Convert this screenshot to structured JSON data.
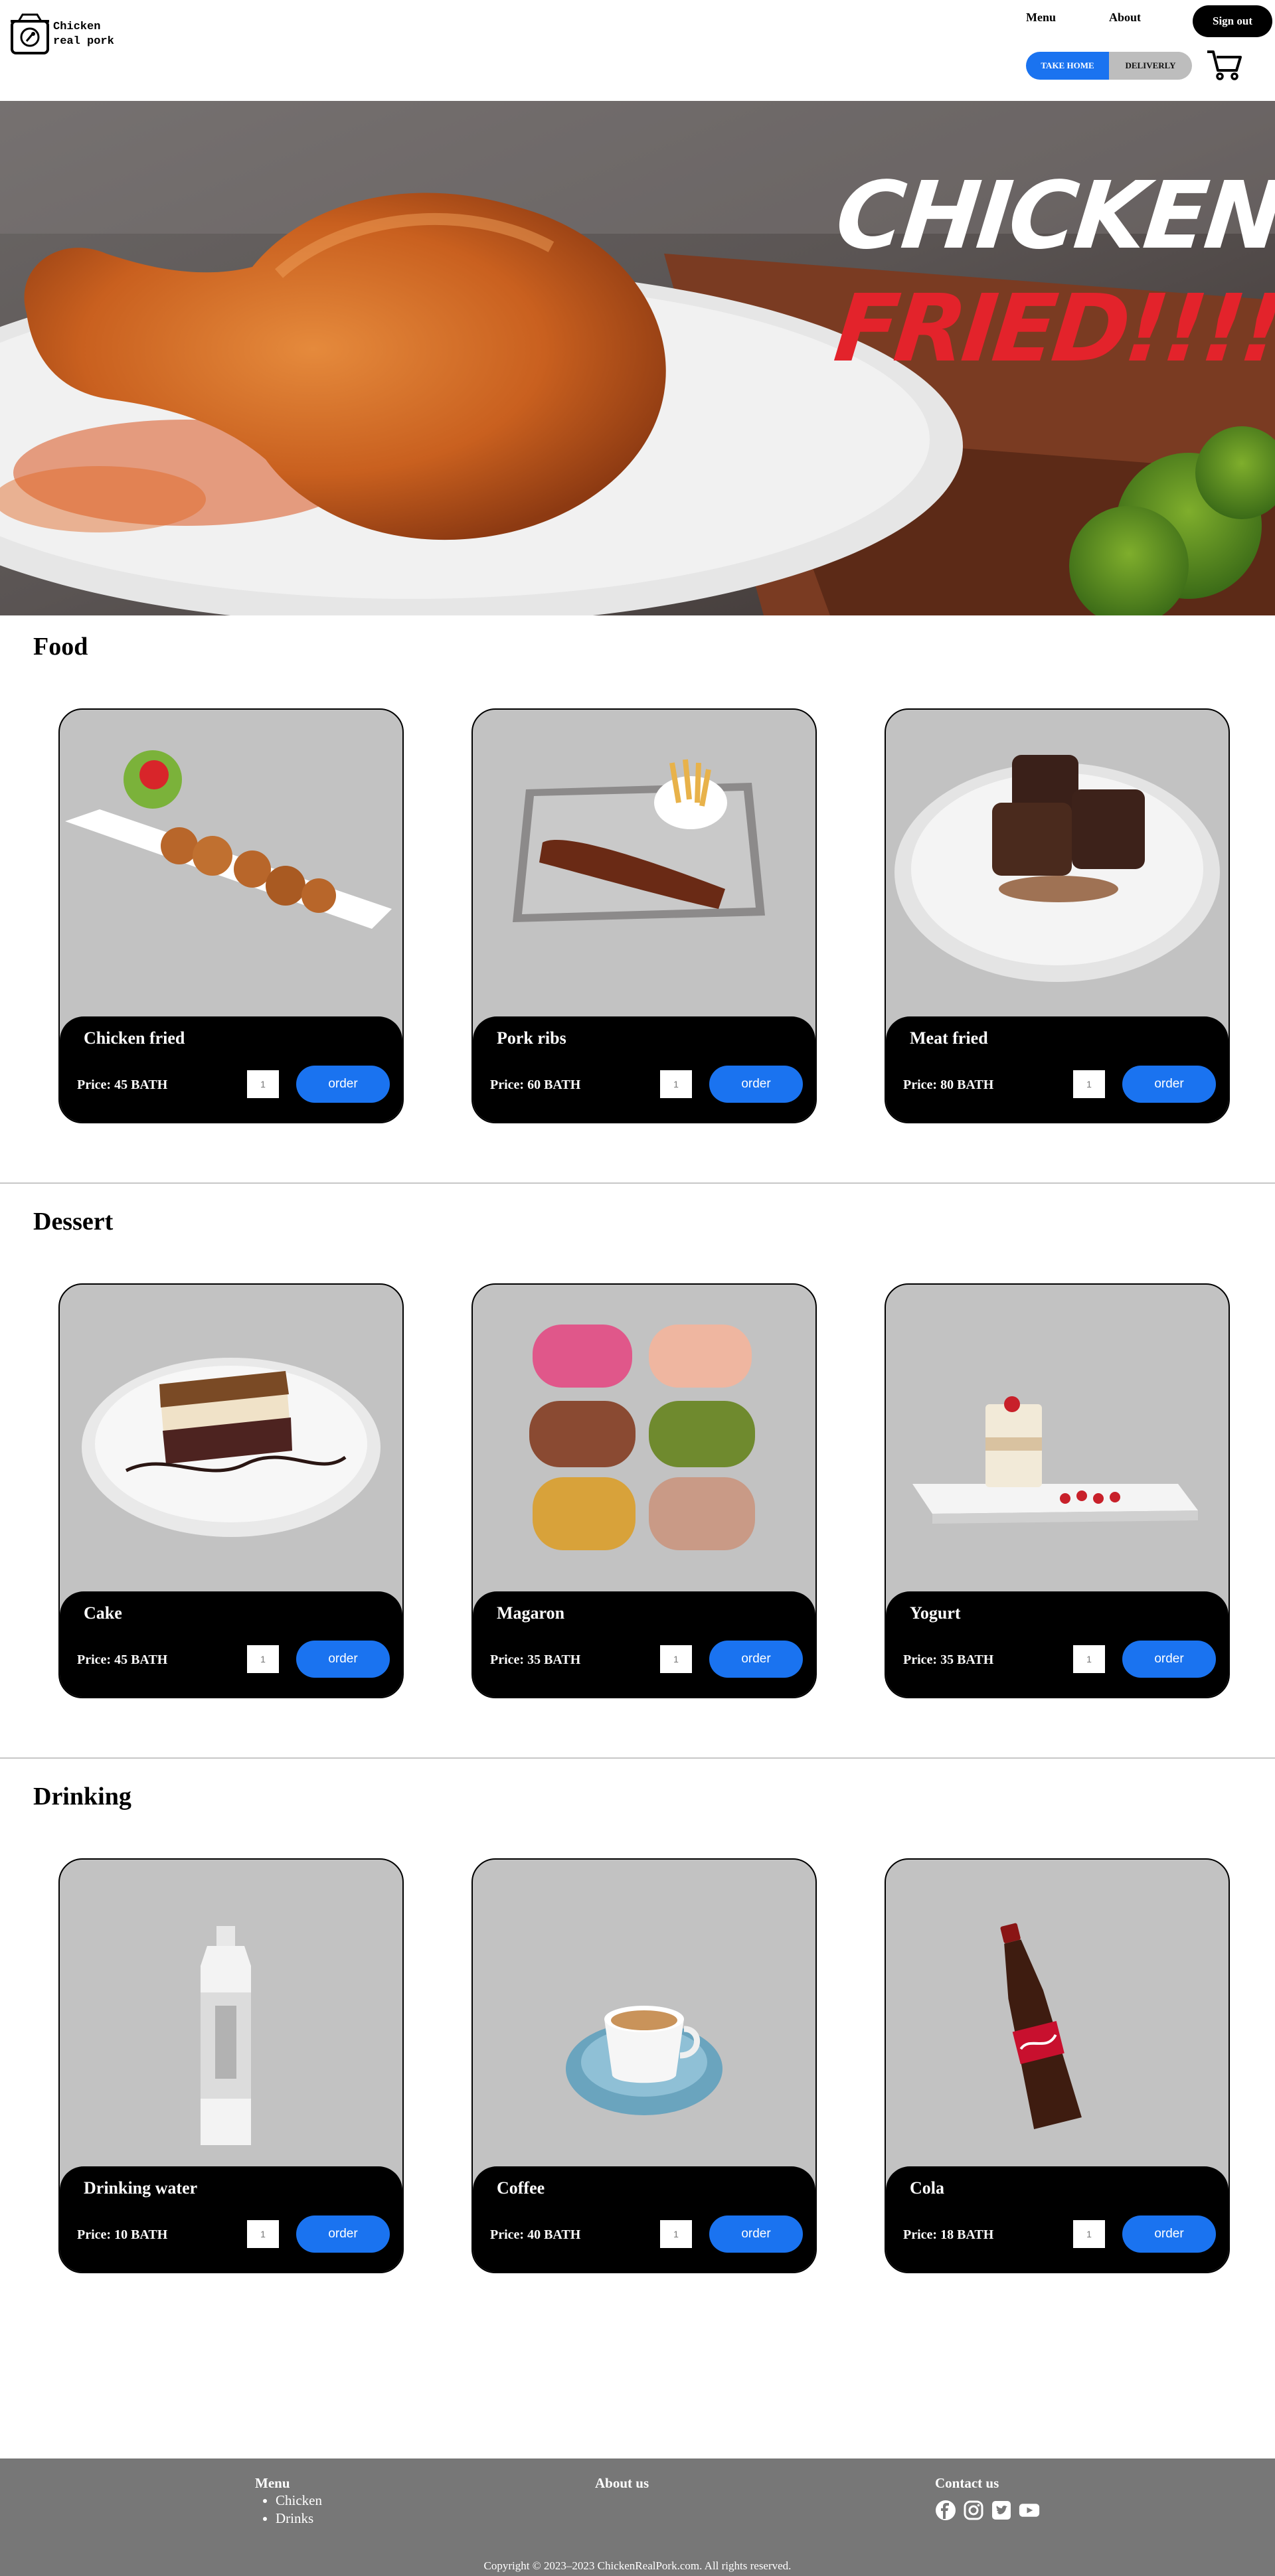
{
  "header": {
    "logo_text": "Chicken\nreal pork",
    "nav": {
      "menu": "Menu",
      "about": "About"
    },
    "sign_out": "Sign out",
    "mode_toggle": {
      "take_home": "TAKE HOME",
      "delivery": "DELIVERLY",
      "selected": "TAKE HOME"
    },
    "icons": {
      "logo": "pot-icon",
      "cart": "cart-icon"
    }
  },
  "hero": {
    "line1": "CHICKEN",
    "line2": "FRIED!!!!!!!!"
  },
  "sections": [
    {
      "title": "Food",
      "items": [
        {
          "name": "Chicken fried",
          "price": "Price: 45 BATH",
          "qty_placeholder": "1",
          "order": "order"
        },
        {
          "name": "Pork ribs",
          "price": "Price: 60 BATH",
          "qty_placeholder": "1",
          "order": "order"
        },
        {
          "name": "Meat fried",
          "price": "Price: 80 BATH",
          "qty_placeholder": "1",
          "order": "order"
        }
      ]
    },
    {
      "title": "Dessert",
      "items": [
        {
          "name": "Cake",
          "price": "Price: 45 BATH",
          "qty_placeholder": "1",
          "order": "order"
        },
        {
          "name": "Magaron",
          "price": "Price: 35 BATH",
          "qty_placeholder": "1",
          "order": "order"
        },
        {
          "name": "Yogurt",
          "price": "Price: 35 BATH",
          "qty_placeholder": "1",
          "order": "order"
        }
      ]
    },
    {
      "title": "Drinking",
      "items": [
        {
          "name": "Drinking water",
          "price": "Price: 10 BATH",
          "qty_placeholder": "1",
          "order": "order"
        },
        {
          "name": "Coffee",
          "price": "Price: 40 BATH",
          "qty_placeholder": "1",
          "order": "order"
        },
        {
          "name": "Cola",
          "price": "Price: 18 BATH",
          "qty_placeholder": "1",
          "order": "order"
        }
      ]
    }
  ],
  "footer": {
    "menu_title": "Menu",
    "menu_items": [
      "Chicken",
      "Drinks"
    ],
    "about_title": "About us",
    "contact_title": "Contact us",
    "social_icons": [
      "facebook-icon",
      "instagram-icon",
      "twitter-icon",
      "youtube-icon"
    ],
    "copyright": "Copyright © 2023–2023 ChickenRealPork.com. All rights reserved."
  },
  "colors": {
    "accent": "#1a73f0",
    "card_bg": "#c2c2c2",
    "footer_bg": "#777777",
    "hero_red": "#e3232b"
  }
}
